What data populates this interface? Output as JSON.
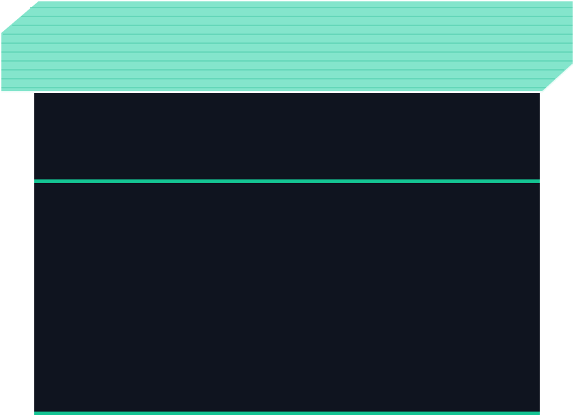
{
  "colors": {
    "background": "#ffffff",
    "awning_fill": "#84e5cc",
    "awning_stripe": "#54cfae",
    "awning_edge": "#ecfbf7",
    "panel": "#0f141f",
    "accent": "#14c493"
  },
  "icons": {
    "awning": "striped-awning-shape"
  }
}
